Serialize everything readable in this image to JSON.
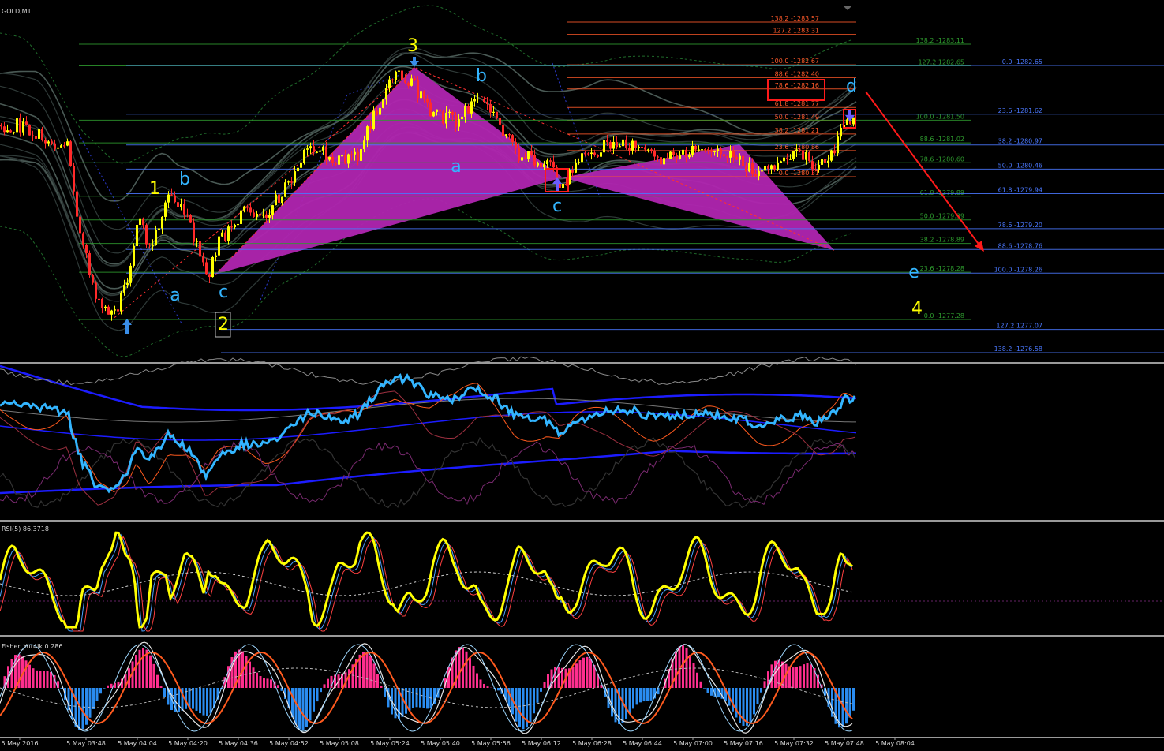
{
  "panels": {
    "main_title": "GOLD,M1",
    "rsi_title": "RSI(5) 86.3718",
    "fisher_title": "Fisher_Yur4ik 0.286"
  },
  "waves": {
    "labels": [
      {
        "t": "1",
        "color": "#ffff00"
      },
      {
        "t": "b",
        "color": "#33b5ff"
      },
      {
        "t": "a",
        "color": "#33b5ff"
      },
      {
        "t": "c",
        "color": "#33b5ff"
      },
      {
        "t": "2",
        "color": "#ffff00"
      },
      {
        "t": "3",
        "color": "#ffff00"
      },
      {
        "t": "b",
        "color": "#33b5ff"
      },
      {
        "t": "a",
        "color": "#33b5ff"
      },
      {
        "t": "c",
        "color": "#33b5ff"
      },
      {
        "t": "d",
        "color": "#33b5ff"
      },
      {
        "t": "e",
        "color": "#33b5ff"
      },
      {
        "t": "4",
        "color": "#ffff00"
      }
    ]
  },
  "fib_sets": [
    {
      "color": "#ff5a2a",
      "levels": [
        {
          "t": "138.2 -1283.57",
          "p": 1283.57
        },
        {
          "t": "127.2 1283.31",
          "p": 1283.31
        },
        {
          "t": "100.0 -1282.67",
          "p": 1282.67
        },
        {
          "t": "88.6 -1282.40",
          "p": 1282.4
        },
        {
          "t": "78.6 -1282.16",
          "p": 1282.16
        },
        {
          "t": "61.8 -1281.77",
          "p": 1281.77
        },
        {
          "t": "50.0 -1281.49",
          "p": 1281.49
        },
        {
          "t": "38.2 -1281.21",
          "p": 1281.21
        },
        {
          "t": "23.6 -1280.86",
          "p": 1280.86
        },
        {
          "t": "0.0 -1280.31",
          "p": 1280.31
        }
      ]
    },
    {
      "color": "#2e9b2e",
      "levels": [
        {
          "t": "138.2 -1283.11",
          "p": 1283.11
        },
        {
          "t": "127.2 1282.65",
          "p": 1282.65
        },
        {
          "t": "100.0 -1281.50",
          "p": 1281.5
        },
        {
          "t": "88.6 -1281.02",
          "p": 1281.02
        },
        {
          "t": "78.6 -1280.60",
          "p": 1280.6
        },
        {
          "t": "61.8 -1279.89",
          "p": 1279.89
        },
        {
          "t": "50.0 -1279.39",
          "p": 1279.39
        },
        {
          "t": "38.2 -1278.89",
          "p": 1278.89
        },
        {
          "t": "23.6 -1278.28",
          "p": 1278.28
        },
        {
          "t": "0.0 -1277.28",
          "p": 1277.28
        }
      ]
    },
    {
      "color": "#4a78ff",
      "levels": [
        {
          "t": "0.0 -1282.65",
          "p": 1282.65
        },
        {
          "t": "23.6 -1281.62",
          "p": 1281.62
        },
        {
          "t": "38.2 -1280.97",
          "p": 1280.97
        },
        {
          "t": "50.0 -1280.46",
          "p": 1280.46
        },
        {
          "t": "61.8 -1279.94",
          "p": 1279.94
        },
        {
          "t": "78.6 -1279.20",
          "p": 1279.2
        },
        {
          "t": "88.6 -1278.76",
          "p": 1278.76
        },
        {
          "t": "100.0 -1278.26",
          "p": 1278.26
        },
        {
          "t": "127.2 1277.07",
          "p": 1277.07
        },
        {
          "t": "138.2 -1276.58",
          "p": 1276.58
        }
      ]
    }
  ],
  "time_axis": [
    "5 May 2016",
    "5 May 03:48",
    "5 May 04:04",
    "5 May 04:20",
    "5 May 04:36",
    "5 May 04:52",
    "5 May 05:08",
    "5 May 05:24",
    "5 May 05:40",
    "5 May 05:56",
    "5 May 06:12",
    "5 May 06:28",
    "5 May 06:44",
    "5 May 07:00",
    "5 May 07:16",
    "5 May 07:32",
    "5 May 07:48",
    "5 May 08:04"
  ],
  "colors": {
    "bull": "#ffff00",
    "bear": "#ff2a2a",
    "pattern": "#b025b0",
    "rsi": "#ffff00",
    "fisher_pos": "#ff2e8e",
    "fisher_neg": "#2a8cf0",
    "wave_blue": "#33b5ff",
    "wave_yellow": "#ffff00"
  },
  "chart_data": {
    "type": "candlestick",
    "symbol": "GOLD,M1",
    "ylim": [
      1276.4,
      1283.8
    ],
    "x_range": [
      "5 May 03:44",
      "5 May 08:06"
    ],
    "ohlc_waypoints": [
      {
        "x": "03:33",
        "close": 1281.4
      },
      {
        "x": "03:45",
        "close": 1281.0
      },
      {
        "x": "03:49",
        "close": 1281.0
      },
      {
        "x": "03:53",
        "close": 1279.0
      },
      {
        "x": "03:59",
        "close": 1277.6
      },
      {
        "x": "04:04",
        "close": 1277.5
      },
      {
        "x": "04:08",
        "close": 1278.3
      },
      {
        "x": "04:11",
        "close": 1279.5
      },
      {
        "x": "04:15",
        "close": 1278.8
      },
      {
        "x": "04:21",
        "close": 1280.0
      },
      {
        "x": "04:27",
        "close": 1279.4
      },
      {
        "x": "04:33",
        "close": 1278.2
      },
      {
        "x": "04:37",
        "close": 1279.0
      },
      {
        "x": "04:45",
        "close": 1279.6
      },
      {
        "x": "04:52",
        "close": 1279.6
      },
      {
        "x": "04:59",
        "close": 1280.2
      },
      {
        "x": "05:06",
        "close": 1281.0
      },
      {
        "x": "05:14",
        "close": 1280.6
      },
      {
        "x": "05:21",
        "close": 1280.8
      },
      {
        "x": "05:27",
        "close": 1281.8
      },
      {
        "x": "05:33",
        "close": 1282.5
      },
      {
        "x": "05:38",
        "close": 1282.3
      },
      {
        "x": "05:44",
        "close": 1281.6
      },
      {
        "x": "05:52",
        "close": 1281.5
      },
      {
        "x": "05:59",
        "close": 1282.0
      },
      {
        "x": "06:05",
        "close": 1281.5
      },
      {
        "x": "06:11",
        "close": 1280.8
      },
      {
        "x": "06:21",
        "close": 1280.6
      },
      {
        "x": "06:25",
        "close": 1280.1
      },
      {
        "x": "06:30",
        "close": 1280.6
      },
      {
        "x": "06:40",
        "close": 1281.0
      },
      {
        "x": "06:48",
        "close": 1281.0
      },
      {
        "x": "06:55",
        "close": 1280.7
      },
      {
        "x": "07:04",
        "close": 1280.8
      },
      {
        "x": "07:12",
        "close": 1280.9
      },
      {
        "x": "07:20",
        "close": 1280.7
      },
      {
        "x": "07:28",
        "close": 1280.4
      },
      {
        "x": "07:35",
        "close": 1280.6
      },
      {
        "x": "07:41",
        "close": 1280.8
      },
      {
        "x": "07:47",
        "close": 1280.5
      },
      {
        "x": "07:52",
        "close": 1280.9
      },
      {
        "x": "07:55",
        "close": 1281.5
      }
    ],
    "rsi": {
      "period": 5,
      "last": 86.3718
    },
    "fisher": {
      "last": 0.286
    }
  }
}
